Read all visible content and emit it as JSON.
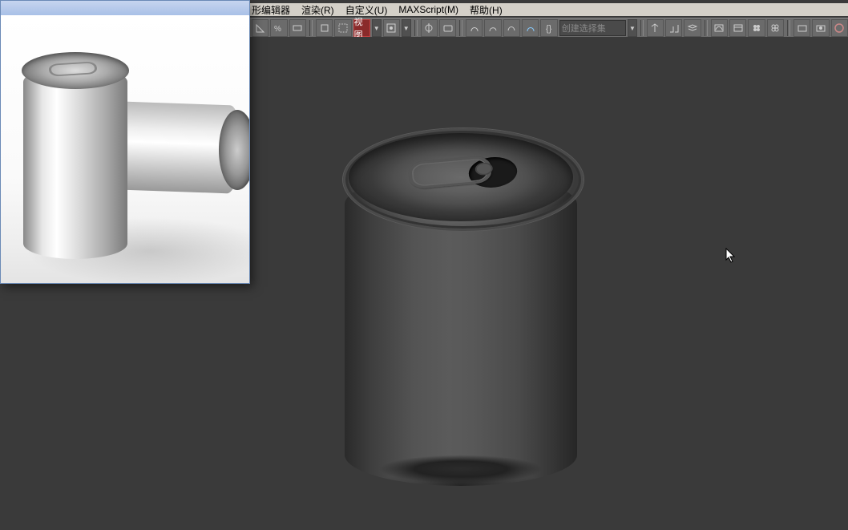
{
  "menu": {
    "graph_editor": "形编辑器",
    "render": "渲染(R)",
    "customize": "自定义(U)",
    "maxscript": "MAXScript(M)",
    "help": "帮助(H)"
  },
  "toolbar": {
    "view_label": "视图",
    "selection_set_placeholder": "创建选择集"
  }
}
